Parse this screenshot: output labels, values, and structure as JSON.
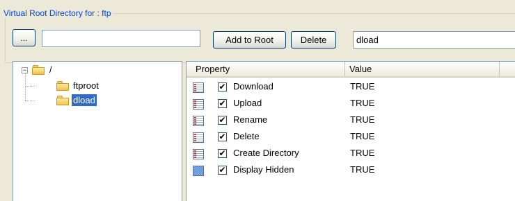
{
  "group": {
    "title": "Virtual Root Directory for : ftp"
  },
  "toolbar": {
    "browse_label": "...",
    "path_value": "",
    "add_label": "Add to Root",
    "delete_label": "Delete",
    "folder_value": "dload"
  },
  "tree": {
    "root_label": "/",
    "expander": "−",
    "children": [
      {
        "label": "ftproot",
        "selected": false
      },
      {
        "label": "dload",
        "selected": true
      }
    ]
  },
  "properties": {
    "columns": [
      "Property",
      "Value"
    ],
    "rows": [
      {
        "icon": "list-icon",
        "checked": true,
        "name": "Download",
        "value": "TRUE"
      },
      {
        "icon": "list-icon",
        "checked": true,
        "name": "Upload",
        "value": "TRUE"
      },
      {
        "icon": "list-icon",
        "checked": true,
        "name": "Rename",
        "value": "TRUE"
      },
      {
        "icon": "list-icon",
        "checked": true,
        "name": "Delete",
        "value": "TRUE"
      },
      {
        "icon": "list-icon",
        "checked": true,
        "name": "Create Directory",
        "value": "TRUE"
      },
      {
        "icon": "hidden-icon",
        "checked": true,
        "name": "Display Hidden",
        "value": "TRUE"
      }
    ],
    "check_glyph": "✔"
  },
  "colors": {
    "group_title": "#0046d5",
    "selection": "#316ac5",
    "background": "#ece9d8"
  }
}
